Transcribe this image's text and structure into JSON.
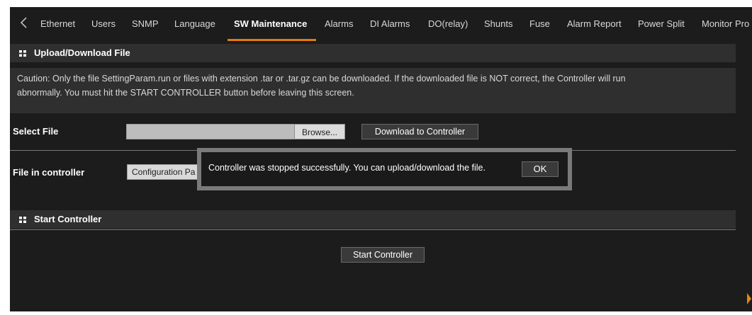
{
  "nav": {
    "tabs": [
      {
        "label": "Ethernet"
      },
      {
        "label": "Users"
      },
      {
        "label": "SNMP"
      },
      {
        "label": "Language"
      },
      {
        "label": "SW Maintenance"
      },
      {
        "label": "Alarms"
      },
      {
        "label": "DI Alarms"
      },
      {
        "label": "DO(relay)"
      },
      {
        "label": "Shunts"
      },
      {
        "label": "Fuse"
      },
      {
        "label": "Alarm Report"
      },
      {
        "label": "Power Split"
      },
      {
        "label": "Monitor Pro"
      }
    ],
    "active_tab": "SW Maintenance",
    "accent_color": "#e07b10"
  },
  "upload_section": {
    "title": "Upload/Download File",
    "caution_line1": "Caution: Only the file SettingParam.run or files with extension .tar or .tar.gz can be downloaded. If the downloaded file is NOT correct, the Controller will run",
    "caution_line2": "abnormally. You must hit the START CONTROLLER button before leaving this screen.",
    "select_file_label": "Select File",
    "file_value": "",
    "browse_label": "Browse...",
    "download_label": "Download to Controller",
    "file_in_controller_label": "File in controller",
    "file_in_controller_value": "Configuration Pa"
  },
  "start_section": {
    "title": "Start Controller",
    "start_label": "Start Controller"
  },
  "modal": {
    "message": "Controller was stopped successfully. You can upload/download the file.",
    "ok_label": "OK"
  },
  "icons": {
    "back": "chevron-left-icon",
    "section": "grid-icon",
    "scroll_right": "play-right-icon"
  }
}
